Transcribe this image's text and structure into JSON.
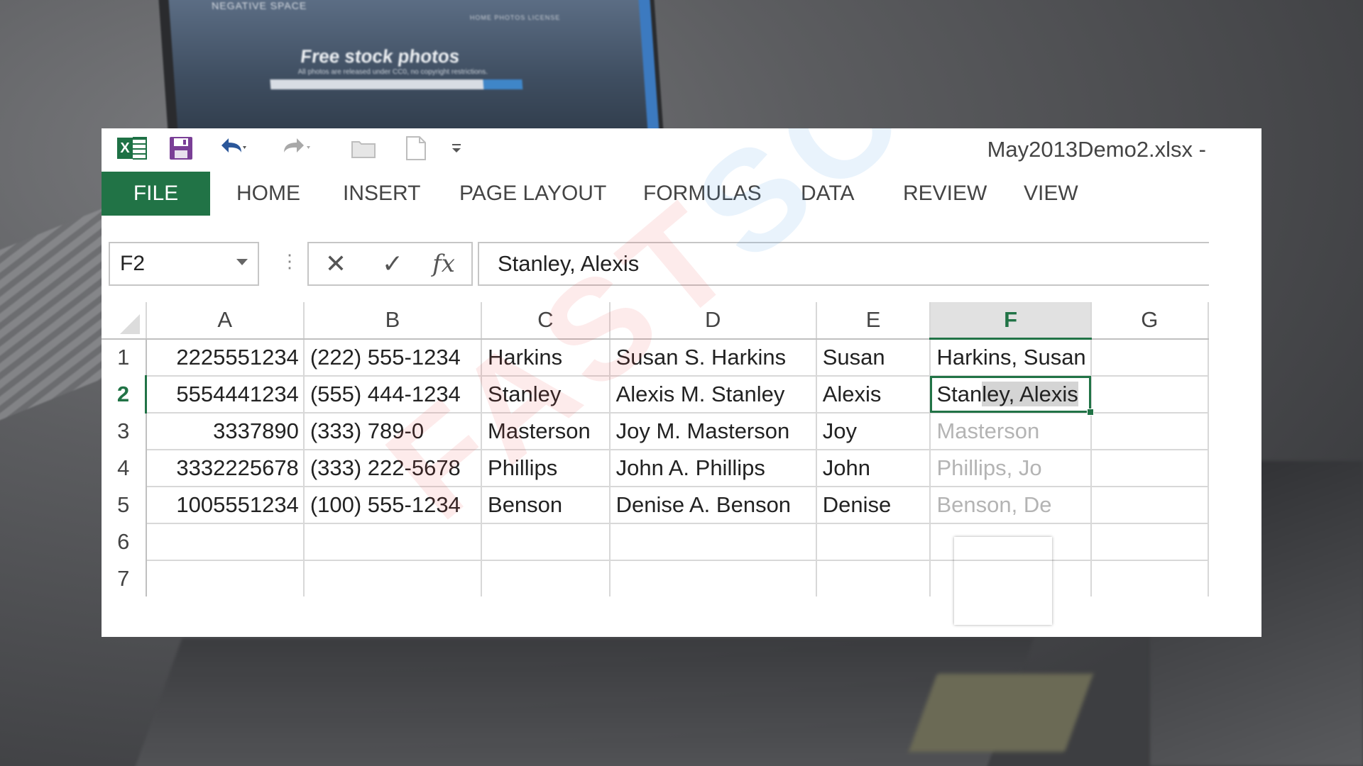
{
  "window": {
    "title": "May2013Demo2.xlsx -"
  },
  "background": {
    "site_brand": "NEGATIVE SPACE",
    "site_nav": "HOME   PHOTOS   LICENSE",
    "site_headline": "Free stock photos",
    "site_sub": "All photos are released under CC0, no copyright restrictions."
  },
  "ribbon": {
    "tabs": [
      {
        "label": "FILE",
        "active": true
      },
      {
        "label": "HOME"
      },
      {
        "label": "INSERT"
      },
      {
        "label": "PAGE LAYOUT"
      },
      {
        "label": "FORMULAS"
      },
      {
        "label": "DATA"
      },
      {
        "label": "REVIEW"
      },
      {
        "label": "VIEW"
      }
    ]
  },
  "formula_bar": {
    "name_box": "F2",
    "fx_label": "fx",
    "value": "Stanley, Alexis"
  },
  "sheet": {
    "columns": [
      "A",
      "B",
      "C",
      "D",
      "E",
      "F",
      "G"
    ],
    "active_column": "F",
    "active_row": "2",
    "rows": [
      {
        "n": "1",
        "A": "2225551234",
        "B": "(222) 555-1234",
        "C": "Harkins",
        "D": "Susan S. Harkins",
        "E": "Susan",
        "F": "Harkins, Susan",
        "G": ""
      },
      {
        "n": "2",
        "A": "5554441234",
        "B": "(555) 444-1234",
        "C": "Stanley",
        "D": "Alexis M. Stanley",
        "E": "Alexis",
        "F_typed": "Stan",
        "F_suggest": "ley, Alexis",
        "G": ""
      },
      {
        "n": "3",
        "A": "3337890",
        "B": "(333) 789-0",
        "C": "Masterson",
        "D": "Joy M. Masterson",
        "E": "Joy",
        "F": "Masterson",
        "G": ""
      },
      {
        "n": "4",
        "A": "3332225678",
        "B": "(333) 222-5678",
        "C": "Phillips",
        "D": "John A. Phillips",
        "E": "John",
        "F": "Phillips, Jo",
        "G": ""
      },
      {
        "n": "5",
        "A": "1005551234",
        "B": "(100) 555-1234",
        "C": "Benson",
        "D": "Denise A. Benson",
        "E": "Denise",
        "F": "Benson, De",
        "G": ""
      },
      {
        "n": "6"
      },
      {
        "n": "7"
      }
    ]
  },
  "watermark": {
    "part1": "FAST",
    "part2": "SOFTWARES"
  },
  "colors": {
    "excel_green": "#217346",
    "flash_fill_gray": "#b4b4b4"
  }
}
